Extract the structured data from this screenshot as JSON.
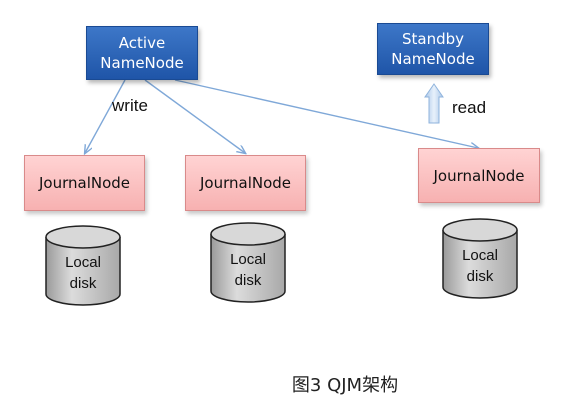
{
  "nodes": {
    "active": {
      "line1": "Active",
      "line2": "NameNode"
    },
    "standby": {
      "line1": "Standby",
      "line2": "NameNode"
    },
    "journal": [
      "JournalNode",
      "JournalNode",
      "JournalNode"
    ],
    "disks": [
      {
        "line1": "Local",
        "line2": "disk"
      },
      {
        "line1": "Local",
        "line2": "disk"
      },
      {
        "line1": "Local",
        "line2": "disk"
      }
    ]
  },
  "edges": {
    "write_label": "write",
    "read_label": "read"
  },
  "caption": "图3 QJM架构",
  "colors": {
    "namenode_fill": "#2a63b8",
    "journalnode_fill": "#ffc9c9",
    "disk_fill": "#c9c9c9",
    "arrow": "#7fa8d8"
  }
}
